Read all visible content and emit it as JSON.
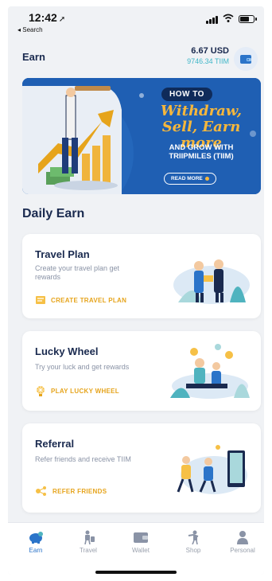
{
  "status_bar": {
    "time": "12:42",
    "back_label": "◂ Search"
  },
  "header": {
    "title": "Earn",
    "balance_usd": "6.67 USD",
    "balance_tiim": "9746.34 TIIM"
  },
  "banner": {
    "tag": "HOW TO",
    "headline_1": "Withdraw,",
    "headline_2": "Sell, Earn more",
    "subline_1": "AND GROW WITH",
    "subline_2": "TRIIPMILES (TIIM)",
    "cta": "READ MORE"
  },
  "section_title": "Daily Earn",
  "cards": [
    {
      "title": "Travel Plan",
      "desc": "Create your travel plan get rewards",
      "action": "CREATE TRAVEL PLAN"
    },
    {
      "title": "Lucky Wheel",
      "desc": "Try your luck and get rewards",
      "action": "PLAY LUCKY WHEEL"
    },
    {
      "title": "Referral",
      "desc": "Refer friends and receive TIIM",
      "action": "REFER FRIENDS"
    }
  ],
  "tabs": [
    {
      "label": "Earn",
      "icon": "piggy-bank-icon"
    },
    {
      "label": "Travel",
      "icon": "traveler-icon"
    },
    {
      "label": "Wallet",
      "icon": "wallet-icon"
    },
    {
      "label": "Shop",
      "icon": "shop-icon"
    },
    {
      "label": "Personal",
      "icon": "person-icon"
    }
  ],
  "colors": {
    "accent": "#2b74c9",
    "action": "#e6a41c",
    "navy": "#1a2a4f",
    "banner_blue": "#1f5fb3",
    "tiim_teal": "#3fb6c8"
  }
}
